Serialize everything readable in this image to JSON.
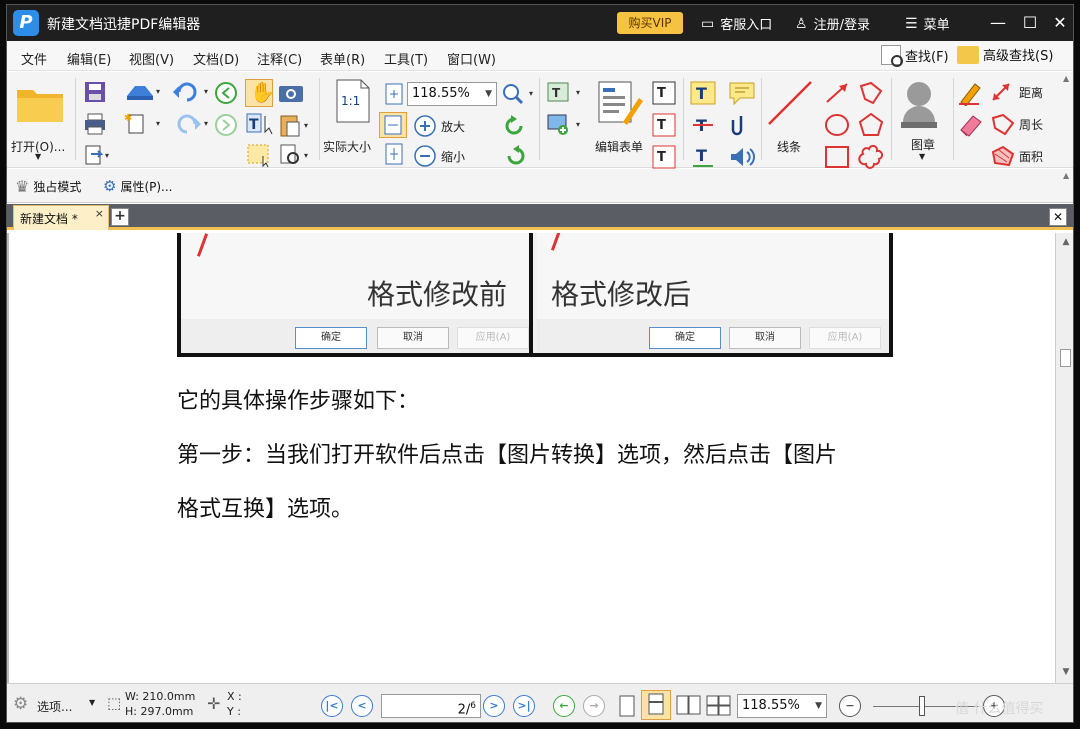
{
  "titlebar": {
    "title": "新建文档迅捷PDF编辑器",
    "logo": "P",
    "vip": "购买VIP",
    "service": "客服入口",
    "login": "注册/登录",
    "menu": "菜单"
  },
  "menubar": {
    "items": [
      "文件",
      "编辑(E)",
      "视图(V)",
      "文档(D)",
      "注释(C)",
      "表单(R)",
      "工具(T)",
      "窗口(W)"
    ],
    "find": "查找(F)",
    "advanced_find": "高级查找(S)"
  },
  "ribbon": {
    "open": "打开(O)...",
    "actual_size": "实际大小",
    "zoom": "118.55%",
    "zoom_in": "放大",
    "zoom_out": "缩小",
    "edit_form": "编辑表单",
    "line": "线条",
    "stamp": "图章",
    "distance": "距离",
    "perimeter": "周长",
    "area": "面积",
    "one_to_one": "1:1"
  },
  "quickbar": {
    "exclusive": "独占模式",
    "properties": "属性(P)..."
  },
  "tabs": {
    "active": "新建文档 *"
  },
  "document": {
    "caption_before": "格式修改前",
    "caption_after": "格式修改后",
    "btn_ok": "确定",
    "btn_cancel": "取消",
    "btn_apply": "应用(A)",
    "para1": "它的具体操作步骤如下：",
    "para2": "第一步：当我们打开软件后点击【图片转换】选项，然后点击【图片",
    "para3": "格式互换】选项。"
  },
  "statusbar": {
    "options": "选项...",
    "width": "W: 210.0mm",
    "height": "H: 297.0mm",
    "x": "X :",
    "y": "Y :",
    "page_current": "2",
    "page_total": "6",
    "zoom": "118.55%",
    "watermark": "值 什么值得买"
  }
}
